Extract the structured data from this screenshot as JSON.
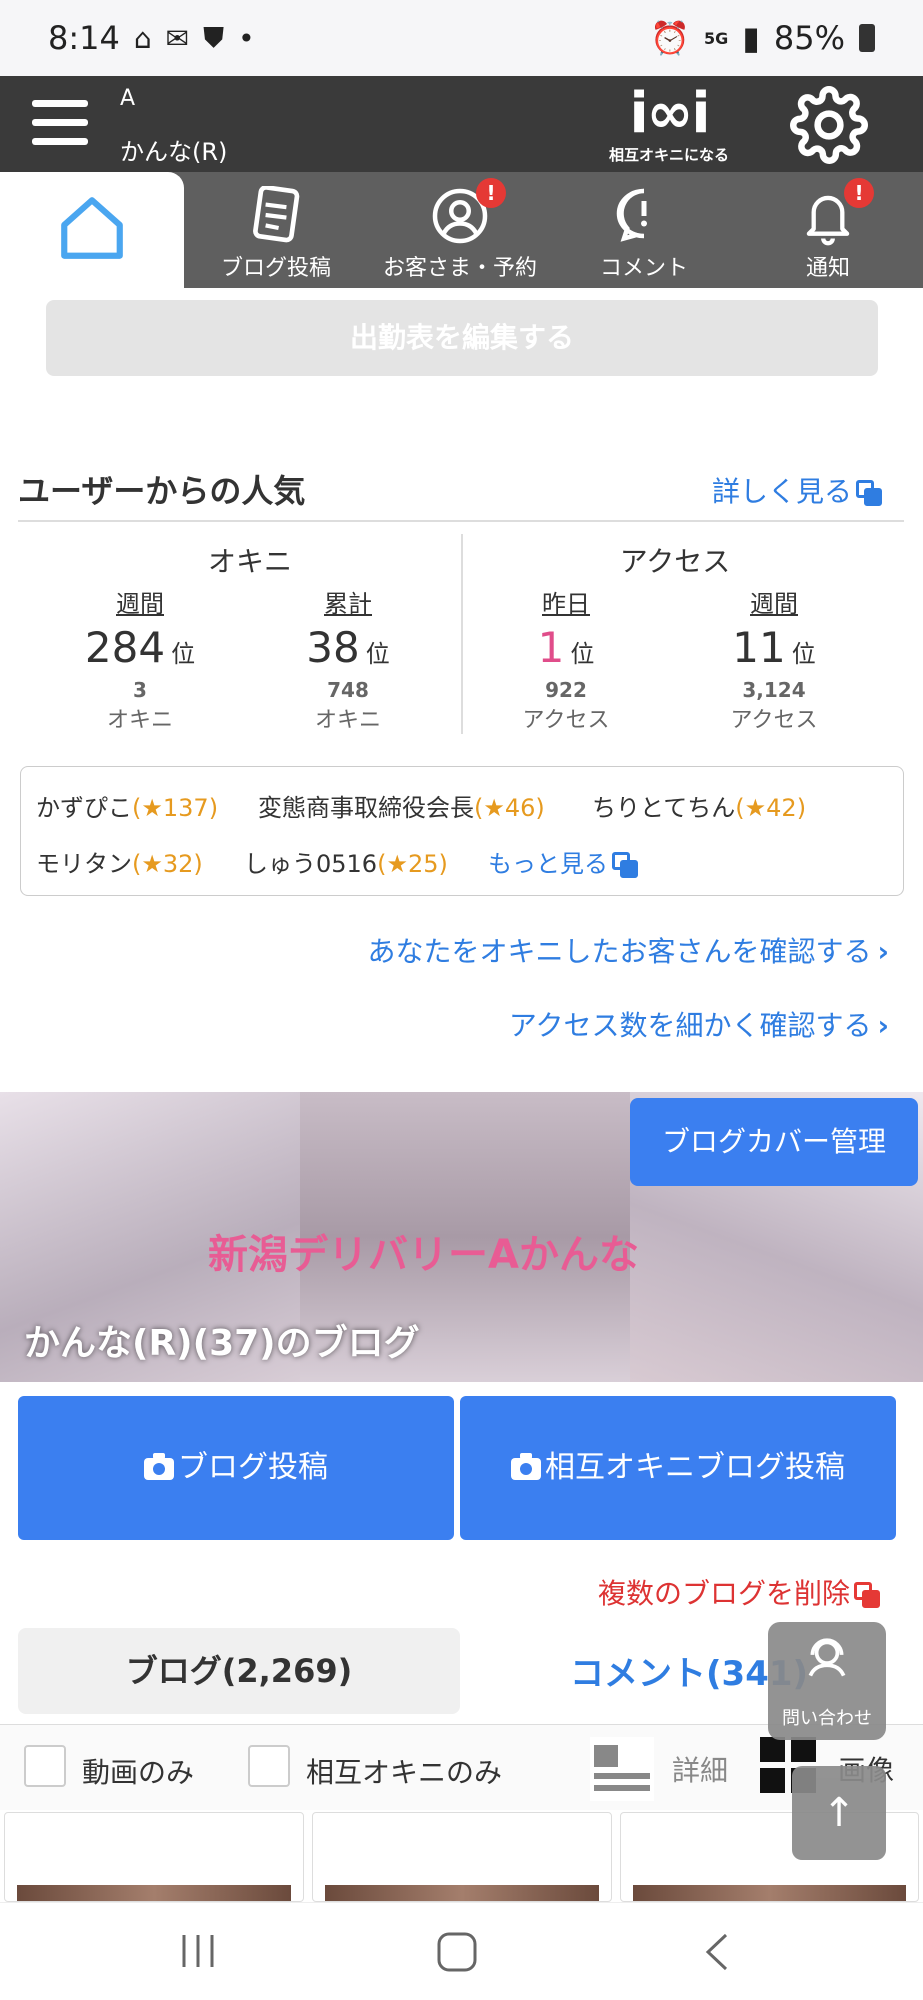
{
  "status_bar": {
    "time": "8:14",
    "network": "5G",
    "battery": "85%"
  },
  "header": {
    "account_initial": "A",
    "account_name": "かんな(R)",
    "logo_text": "i∞i",
    "logo_sub": "相互オキニになる"
  },
  "tabs": [
    {
      "label": "",
      "icon": "home-icon",
      "active": true
    },
    {
      "label": "ブログ投稿",
      "icon": "document-icon"
    },
    {
      "label": "お客さま・予約",
      "icon": "user-icon",
      "badge": "!"
    },
    {
      "label": "コメント",
      "icon": "comment-icon"
    },
    {
      "label": "通知",
      "icon": "bell-icon",
      "badge": "!"
    }
  ],
  "schedule_button": "出勤表を編集する",
  "popularity": {
    "title": "ユーザーからの人気",
    "detail_link": "詳しく見る",
    "okini": {
      "title": "オキニ",
      "weekly": {
        "period": "週間",
        "rank": "284",
        "rank_unit": "位",
        "count": "3",
        "unit": "オキニ"
      },
      "total": {
        "period": "累計",
        "rank": "38",
        "rank_unit": "位",
        "count": "748",
        "unit": "オキニ"
      }
    },
    "access": {
      "title": "アクセス",
      "yesterday": {
        "period": "昨日",
        "rank": "1",
        "rank_unit": "位",
        "count": "922",
        "unit": "アクセス"
      },
      "weekly": {
        "period": "週間",
        "rank": "11",
        "rank_unit": "位",
        "count": "3,124",
        "unit": "アクセス"
      }
    },
    "fans": [
      {
        "name": "かずぴこ",
        "stars": "(★137)"
      },
      {
        "name": "変態商事取締役会長",
        "stars": "(★46)"
      },
      {
        "name": "ちりとてちん",
        "stars": "(★42)"
      },
      {
        "name": "モリタン",
        "stars": "(★32)"
      },
      {
        "name": "しゅう0516",
        "stars": "(★25)"
      }
    ],
    "more_link": "もっと見る"
  },
  "links": {
    "check_okini": "あなたをオキニしたお客さんを確認する",
    "check_access": "アクセス数を細かく確認する"
  },
  "banner": {
    "overlay_text": "新潟デリバリーAかんな",
    "blog_name": "かんな(R)(37)のブログ",
    "cover_button": "ブログカバー管理"
  },
  "buttons": {
    "blog_post": "ブログ投稿",
    "mutual_post": "相互オキニブログ投稿",
    "delete_multiple": "複数のブログを削除"
  },
  "list_tabs": {
    "blog": "ブログ(2,269)",
    "comment": "コメント(341)"
  },
  "contact_fab": "問い合わせ",
  "filters": {
    "video_only": "動画のみ",
    "mutual_only": "相互オキニのみ",
    "view_detail": "詳細",
    "view_image": "画像"
  },
  "colors": {
    "accent_blue": "#3b7ff0",
    "link_blue": "#2f7de1",
    "header_dark": "#3a3a3a",
    "alert_red": "#e53935",
    "rank_pink": "#e04d8a",
    "star_orange": "#e69a1f"
  }
}
